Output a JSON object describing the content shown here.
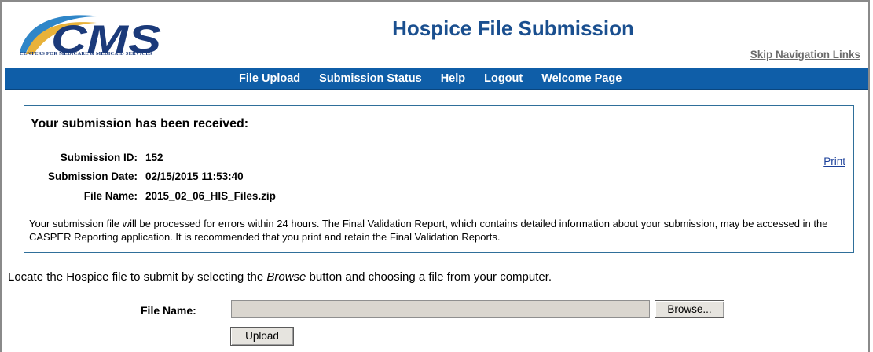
{
  "header": {
    "logo_text": "CMS",
    "logo_subtext": "CENTERS FOR MEDICARE & MEDICAID SERVICES",
    "app_title": "Hospice File Submission",
    "skip_link": "Skip Navigation Links"
  },
  "nav": {
    "items": [
      "File Upload",
      "Submission Status",
      "Help",
      "Logout",
      "Welcome Page"
    ]
  },
  "confirmation": {
    "title": "Your submission has been received:",
    "print_label": "Print",
    "fields": [
      {
        "label": "Submission ID:",
        "value": "152"
      },
      {
        "label": "Submission Date:",
        "value": "02/15/2015 11:53:40"
      },
      {
        "label": "File Name:",
        "value": "2015_02_06_HIS_Files.zip"
      }
    ],
    "message": "Your submission file will be processed for errors within 24 hours. The Final Validation Report, which contains detailed information about your submission, may be accessed in the CASPER Reporting application. It is recommended that you print and retain the Final Validation Reports."
  },
  "instruction": {
    "before": "Locate the Hospice file to submit by selecting the ",
    "emphasis": "Browse",
    "after": " button and choosing a file from your computer."
  },
  "upload": {
    "file_label": "File Name:",
    "file_value": "",
    "browse_label": "Browse...",
    "upload_label": "Upload"
  },
  "colors": {
    "nav_background": "#0f5ea8",
    "title": "#1a4f8f",
    "logo_blue": "#1b3a7a",
    "logo_gold": "#e8b23a",
    "logo_light_blue": "#2f86c8"
  }
}
